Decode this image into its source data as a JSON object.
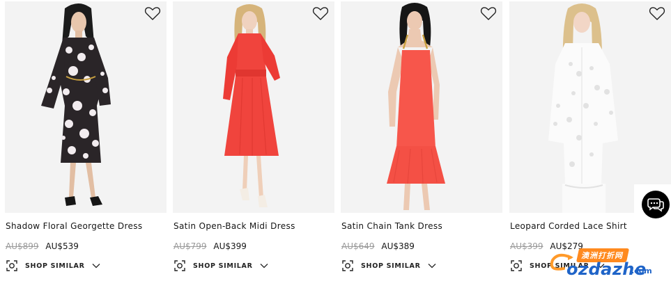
{
  "products": [
    {
      "name": "Shadow Floral Georgette Dress",
      "original_price": "AU$899",
      "sale_price": "AU$539",
      "shop_similar_label": "SHOP SIMILAR",
      "image_alt": "Model wearing black and white floral wrap dress"
    },
    {
      "name": "Satin Open-Back Midi Dress",
      "original_price": "AU$799",
      "sale_price": "AU$399",
      "shop_similar_label": "SHOP SIMILAR",
      "image_alt": "Model wearing red satin long-sleeve midi dress"
    },
    {
      "name": "Satin Chain Tank Dress",
      "original_price": "AU$649",
      "sale_price": "AU$389",
      "shop_similar_label": "SHOP SIMILAR",
      "image_alt": "Model wearing coral satin tank dress with chain straps"
    },
    {
      "name": "Leopard Corded Lace Shirt",
      "original_price": "AU$399",
      "sale_price": "AU$279",
      "shop_similar_label": "SHOP SIMILAR",
      "image_alt": "Model wearing white corded lace shirt"
    }
  ],
  "icons": {
    "favorite": "heart-outline-icon",
    "shop_similar": "scan-camera-icon",
    "expand": "chevron-down-icon",
    "chat": "chat-bubble-icon"
  },
  "colors": {
    "sale_text": "#151515",
    "strikethrough": "#9a9a9a",
    "red_dress": "#f0443d",
    "coral_dress": "#f7564b",
    "image_background": "#f2f2f2",
    "chat_button": "#000000"
  },
  "watermark": {
    "chinese_text": "澳洲打折网",
    "site": "ozdazhe",
    "tld": ".com"
  }
}
